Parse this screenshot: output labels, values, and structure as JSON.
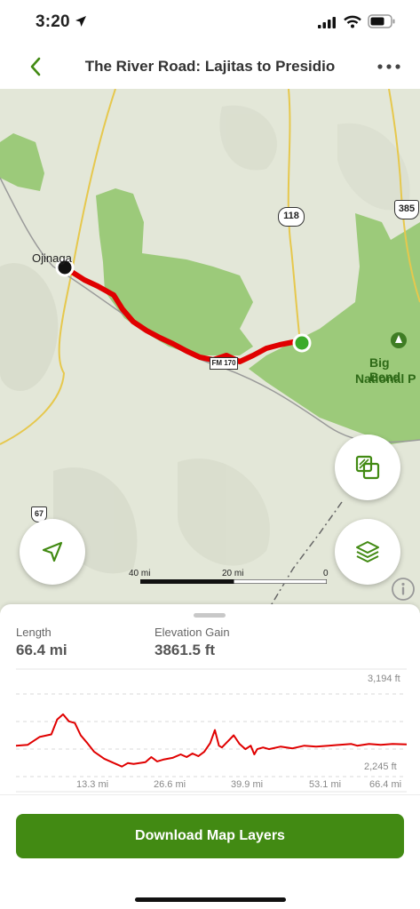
{
  "status_bar": {
    "time": "3:20"
  },
  "nav": {
    "title": "The River Road: Lajitas to Presidio"
  },
  "map": {
    "labels": {
      "ojinaga": "Ojinaga",
      "park_line1": "Big Bend",
      "park_line2": "National P"
    },
    "shields": {
      "hwy118": "118",
      "us385": "385",
      "hwy67": "67",
      "fm170": "FM 170"
    },
    "scale": {
      "left": "40 mi",
      "mid": "20 mi",
      "right": "0"
    }
  },
  "stats": {
    "length_label": "Length",
    "length_value": "66.4 mi",
    "gain_label": "Elevation Gain",
    "gain_value": "3861.5 ft"
  },
  "chart_data": {
    "type": "line",
    "x_ticks": [
      "13.3 mi",
      "26.6 mi",
      "39.9 mi",
      "53.1 mi",
      "66.4 mi"
    ],
    "y_max_label": "3,194 ft",
    "y_min_label": "2,245 ft",
    "ylim": [
      2245,
      3194
    ],
    "xlim": [
      0,
      66.4
    ],
    "series": [
      {
        "color": "#e00000",
        "points": [
          [
            0,
            2600
          ],
          [
            2,
            2610
          ],
          [
            4,
            2700
          ],
          [
            6,
            2730
          ],
          [
            7,
            2900
          ],
          [
            8,
            2960
          ],
          [
            9,
            2880
          ],
          [
            10,
            2860
          ],
          [
            11,
            2720
          ],
          [
            12,
            2640
          ],
          [
            13.3,
            2530
          ],
          [
            15,
            2450
          ],
          [
            17,
            2390
          ],
          [
            18,
            2360
          ],
          [
            19,
            2400
          ],
          [
            20,
            2390
          ],
          [
            22,
            2410
          ],
          [
            23,
            2470
          ],
          [
            24,
            2420
          ],
          [
            25,
            2440
          ],
          [
            26.6,
            2460
          ],
          [
            28,
            2500
          ],
          [
            29,
            2470
          ],
          [
            30,
            2510
          ],
          [
            31,
            2480
          ],
          [
            32,
            2530
          ],
          [
            33,
            2630
          ],
          [
            33.8,
            2780
          ],
          [
            34.5,
            2600
          ],
          [
            35,
            2580
          ],
          [
            36,
            2650
          ],
          [
            37,
            2720
          ],
          [
            38,
            2620
          ],
          [
            39,
            2560
          ],
          [
            39.9,
            2600
          ],
          [
            40.5,
            2500
          ],
          [
            41,
            2560
          ],
          [
            42,
            2580
          ],
          [
            43,
            2560
          ],
          [
            45,
            2590
          ],
          [
            47,
            2570
          ],
          [
            49,
            2600
          ],
          [
            51,
            2590
          ],
          [
            53.1,
            2600
          ],
          [
            55,
            2610
          ],
          [
            57,
            2620
          ],
          [
            58,
            2600
          ],
          [
            60,
            2620
          ],
          [
            62,
            2610
          ],
          [
            64,
            2620
          ],
          [
            66.4,
            2615
          ]
        ]
      }
    ]
  },
  "button": {
    "download_label": "Download Map Layers"
  },
  "colors": {
    "accent": "#428a13",
    "route": "#e00000",
    "park": "#8fc46a"
  }
}
